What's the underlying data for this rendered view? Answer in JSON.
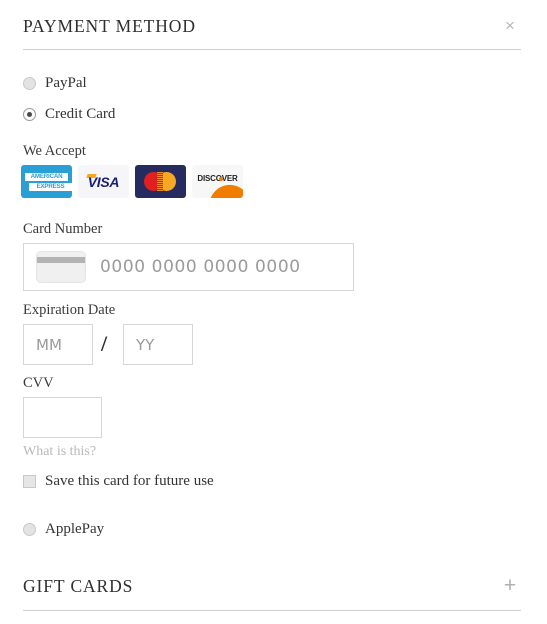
{
  "payment_section": {
    "title": "PAYMENT METHOD",
    "close_icon": "close-icon",
    "close_glyph": "×"
  },
  "methods": [
    {
      "id": "paypal",
      "label": "PayPal",
      "selected": false
    },
    {
      "id": "credit",
      "label": "Credit Card",
      "selected": true
    },
    {
      "id": "applepay",
      "label": "ApplePay",
      "selected": false
    }
  ],
  "we_accept": {
    "label": "We Accept",
    "brands": [
      {
        "id": "amex",
        "name": "american-express-logo",
        "line1": "AMERICAN",
        "line2": "EXPRESS",
        "bg": "#2a9fd6"
      },
      {
        "id": "visa",
        "name": "visa-logo",
        "text": "VISA",
        "bg": "#f6f6f8",
        "fg": "#1a1f71"
      },
      {
        "id": "mastercard",
        "name": "mastercard-logo",
        "bg": "#252b5f",
        "left_circle": "#e02020",
        "right_circle": "#f7a823"
      },
      {
        "id": "discover",
        "name": "discover-logo",
        "text": "DISCOVER",
        "bg": "#f7f7f7",
        "accent": "#f07d00"
      }
    ]
  },
  "card_number": {
    "label": "Card Number",
    "placeholder": "0000 0000 0000 0000",
    "value": "",
    "icon": "credit-card-icon"
  },
  "expiration": {
    "label": "Expiration Date",
    "month_placeholder": "MM",
    "month_value": "",
    "year_placeholder": "YY",
    "year_value": "",
    "separator": "/"
  },
  "cvv": {
    "label": "CVV",
    "placeholder": "",
    "value": "",
    "help_link": "What is this?"
  },
  "save_card": {
    "label": "Save this card for future use",
    "checked": false
  },
  "gift_section": {
    "title": "GIFT CARDS",
    "expand_icon": "plus-icon",
    "expand_glyph": "+"
  },
  "colors": {
    "text": "#2b2b2b",
    "muted": "#b9b9b9",
    "border": "#d6d6d6",
    "rule": "#cfcfcf"
  }
}
